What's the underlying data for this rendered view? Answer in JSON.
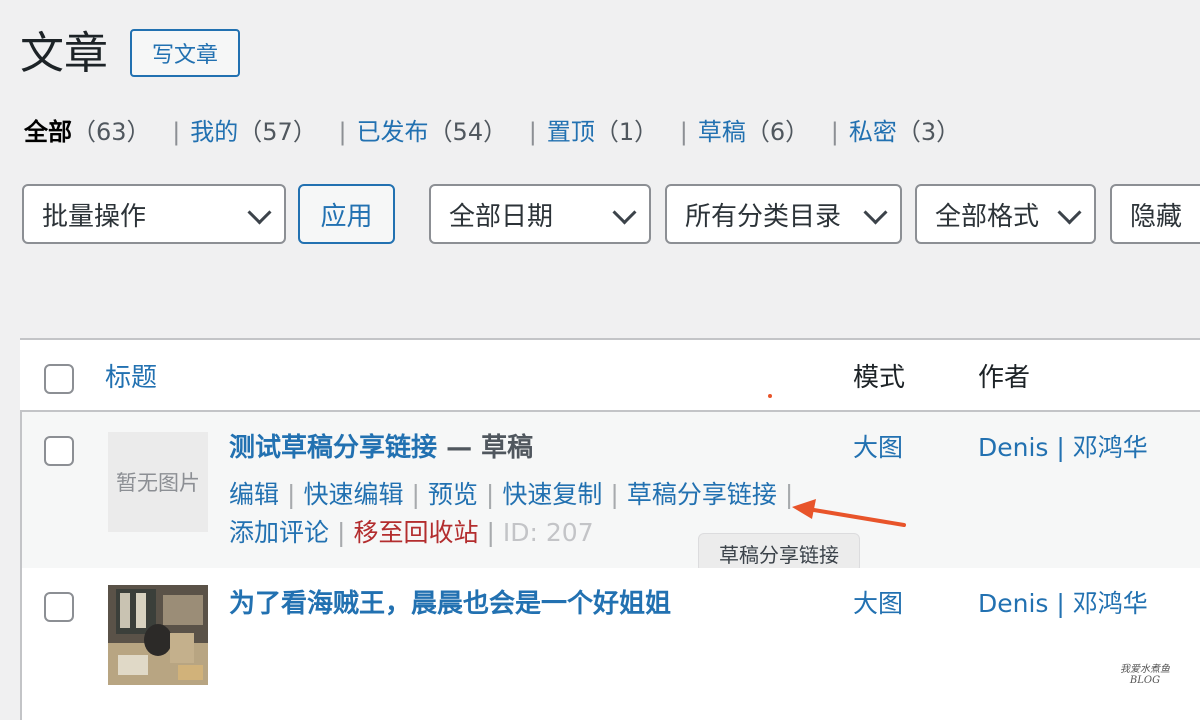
{
  "header": {
    "title": "文章",
    "add_new": "写文章"
  },
  "views": [
    {
      "label": "全部",
      "count": "（63）",
      "current": true
    },
    {
      "label": "我的",
      "count": "（57）"
    },
    {
      "label": "已发布",
      "count": "（54）"
    },
    {
      "label": "置顶",
      "count": "（1）"
    },
    {
      "label": "草稿",
      "count": "（6）"
    },
    {
      "label": "私密",
      "count": "（3）"
    }
  ],
  "separator": "|",
  "filters": {
    "bulk_action": "批量操作",
    "apply": "应用",
    "date": "全部日期",
    "category": "所有分类目录",
    "format": "全部格式",
    "hidden": "隐藏"
  },
  "table": {
    "columns": {
      "title": "标题",
      "mode": "模式",
      "author": "作者"
    },
    "rows": [
      {
        "thumb_text": "暂无图片",
        "title": "测试草稿分享链接",
        "state": " — 草稿",
        "actions": [
          "编辑",
          "快速编辑",
          "预览",
          "快速复制",
          "草稿分享链接"
        ],
        "actions2": [
          "添加评论"
        ],
        "trash": "移至回收站",
        "id": "ID: 207",
        "mode": "大图",
        "author": "Denis",
        "author_sep": " | ",
        "author2": "邓鸿华"
      },
      {
        "title": "为了看海贼王，晨晨也会是一个好姐姐",
        "mode": "大图",
        "author": "Denis",
        "author_sep": " | ",
        "author2": "邓鸿华"
      }
    ]
  },
  "tooltip": "草稿分享链接",
  "arrow_color": "#e8542a",
  "watermark": {
    "line1": "我爱水煮鱼",
    "line2": "BLOG"
  }
}
